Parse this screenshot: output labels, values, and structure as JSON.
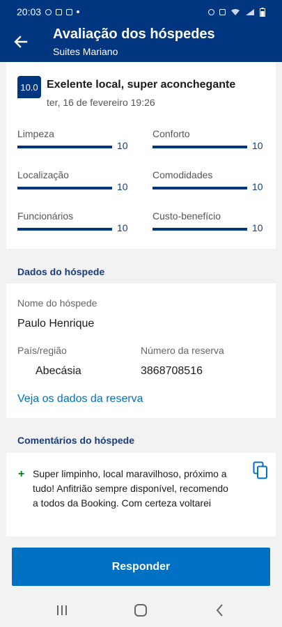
{
  "status_bar": {
    "time": "20:03"
  },
  "header": {
    "title": "Avaliação dos hóspedes",
    "subtitle": "Suites Mariano"
  },
  "review": {
    "score": "10.0",
    "title": "Exelente local, super aconchegante",
    "date": "ter, 16 de fevereiro 19:26",
    "ratings": [
      {
        "label": "Limpeza",
        "value": "10"
      },
      {
        "label": "Conforto",
        "value": "10"
      },
      {
        "label": "Localização",
        "value": "10"
      },
      {
        "label": "Comodidades",
        "value": "10"
      },
      {
        "label": "Funcionários",
        "value": "10"
      },
      {
        "label": "Custo-benefício",
        "value": "10"
      }
    ]
  },
  "guest": {
    "heading": "Dados do hóspede",
    "name_label": "Nome do hóspede",
    "name": "Paulo Henrique",
    "country_label": "País/região",
    "country": "Abecásia",
    "booking_label": "Número da reserva",
    "booking_number": "3868708516",
    "link": "Veja os dados da reserva"
  },
  "comments": {
    "heading": "Comentários do hóspede",
    "positive_mark": "+",
    "text": "Super limpinho, local maravilhoso, próximo a tudo! Anfitrião sempre disponível, recomendo a todos da Booking. Com certeza voltarei"
  },
  "actions": {
    "respond": "Responder"
  },
  "colors": {
    "brand": "#003580",
    "button": "#0071c2",
    "link": "#0071c2",
    "positive": "#008009"
  },
  "icons": {
    "back": "arrow-left-icon",
    "copy": "copy-icon",
    "nav": [
      "recent-apps-icon",
      "home-icon",
      "back-nav-icon"
    ]
  }
}
